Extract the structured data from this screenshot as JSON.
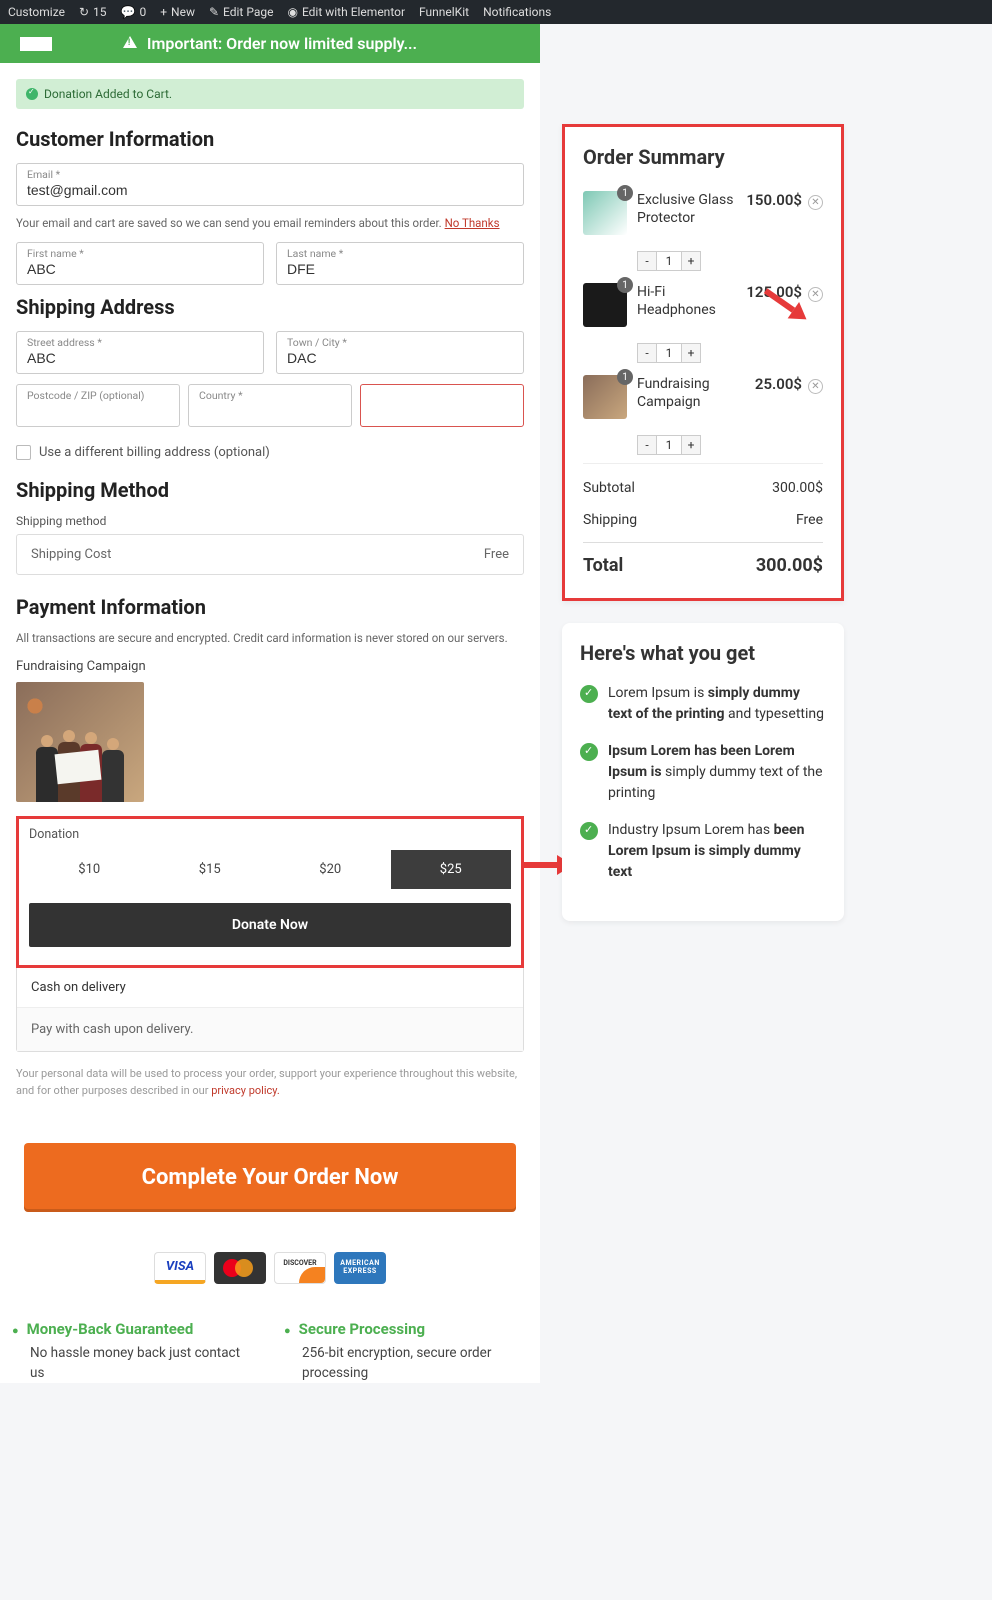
{
  "adminbar": {
    "customize": "Customize",
    "updates": "15",
    "comments": "0",
    "new": "New",
    "edit": "Edit Page",
    "elementor": "Edit with Elementor",
    "funnelkit": "FunnelKit",
    "notifications": "Notifications"
  },
  "banner": "Important: Order now limited supply...",
  "alert": "Donation Added to Cart.",
  "customer_info": {
    "heading": "Customer Information",
    "email_label": "Email *",
    "email_value": "test@gmail.com",
    "reminder_note": "Your email and cart are saved so we can send you email reminders about this order.",
    "no_thanks": "No Thanks",
    "first_label": "First name *",
    "first_value": "ABC",
    "last_label": "Last name *",
    "last_value": "DFE"
  },
  "shipping": {
    "heading": "Shipping Address",
    "street_label": "Street address *",
    "street_value": "ABC",
    "city_label": "Town / City *",
    "city_value": "DAC",
    "postcode_label": "Postcode / ZIP (optional)",
    "country_label": "Country *",
    "diff_billing": "Use a different billing address (optional)"
  },
  "ship_method": {
    "heading": "Shipping Method",
    "label": "Shipping method",
    "name": "Shipping Cost",
    "price": "Free"
  },
  "payment": {
    "heading": "Payment Information",
    "note": "All transactions are secure and encrypted. Credit card information is never stored on our servers.",
    "fund_title": "Fundraising Campaign"
  },
  "donation": {
    "label": "Donation",
    "opts": [
      "$10",
      "$15",
      "$20",
      "$25"
    ],
    "button": "Donate Now"
  },
  "cod": {
    "title": "Cash on delivery",
    "desc": "Pay with cash upon delivery."
  },
  "privacy_pre": "Your personal data will be used to process your order, support your experience throughout this website, and for other purposes described in our ",
  "privacy_link": "privacy policy.",
  "complete": "Complete Your Order Now",
  "paylogos": {
    "visa": "VISA",
    "mc": "MasterCard",
    "discover": "DISCOVER",
    "amex": "AMERICAN EXPRESS"
  },
  "guarantees": [
    {
      "t": "Money-Back Guaranteed",
      "d": "No hassle money back just contact us"
    },
    {
      "t": "Secure Processing",
      "d": "256-bit encryption, secure order processing"
    }
  ],
  "order_summary": {
    "title": "Order Summary",
    "items": [
      {
        "name": "Exclusive Glass Protector",
        "qty": "1",
        "price": "150.00$"
      },
      {
        "name": "Hi-Fi Headphones",
        "qty": "1",
        "price": "125.00$"
      },
      {
        "name": "Fundraising Campaign",
        "qty": "1",
        "price": "25.00$"
      }
    ],
    "subtotal_l": "Subtotal",
    "subtotal_v": "300.00$",
    "shipping_l": "Shipping",
    "shipping_v": "Free",
    "total_l": "Total",
    "total_v": "300.00$"
  },
  "what_you_get": {
    "title": "Here's what you get",
    "items": [
      {
        "pre": "Lorem Ipsum is ",
        "b": "simply dummy text of the printing",
        "post": " and typesetting"
      },
      {
        "pre": "",
        "b": "Ipsum Lorem has been Lorem Ipsum is",
        "post": " simply dummy text of the printing"
      },
      {
        "pre": "Industry Ipsum Lorem has ",
        "b": "been Lorem Ipsum is simply dummy text",
        "post": ""
      }
    ]
  }
}
